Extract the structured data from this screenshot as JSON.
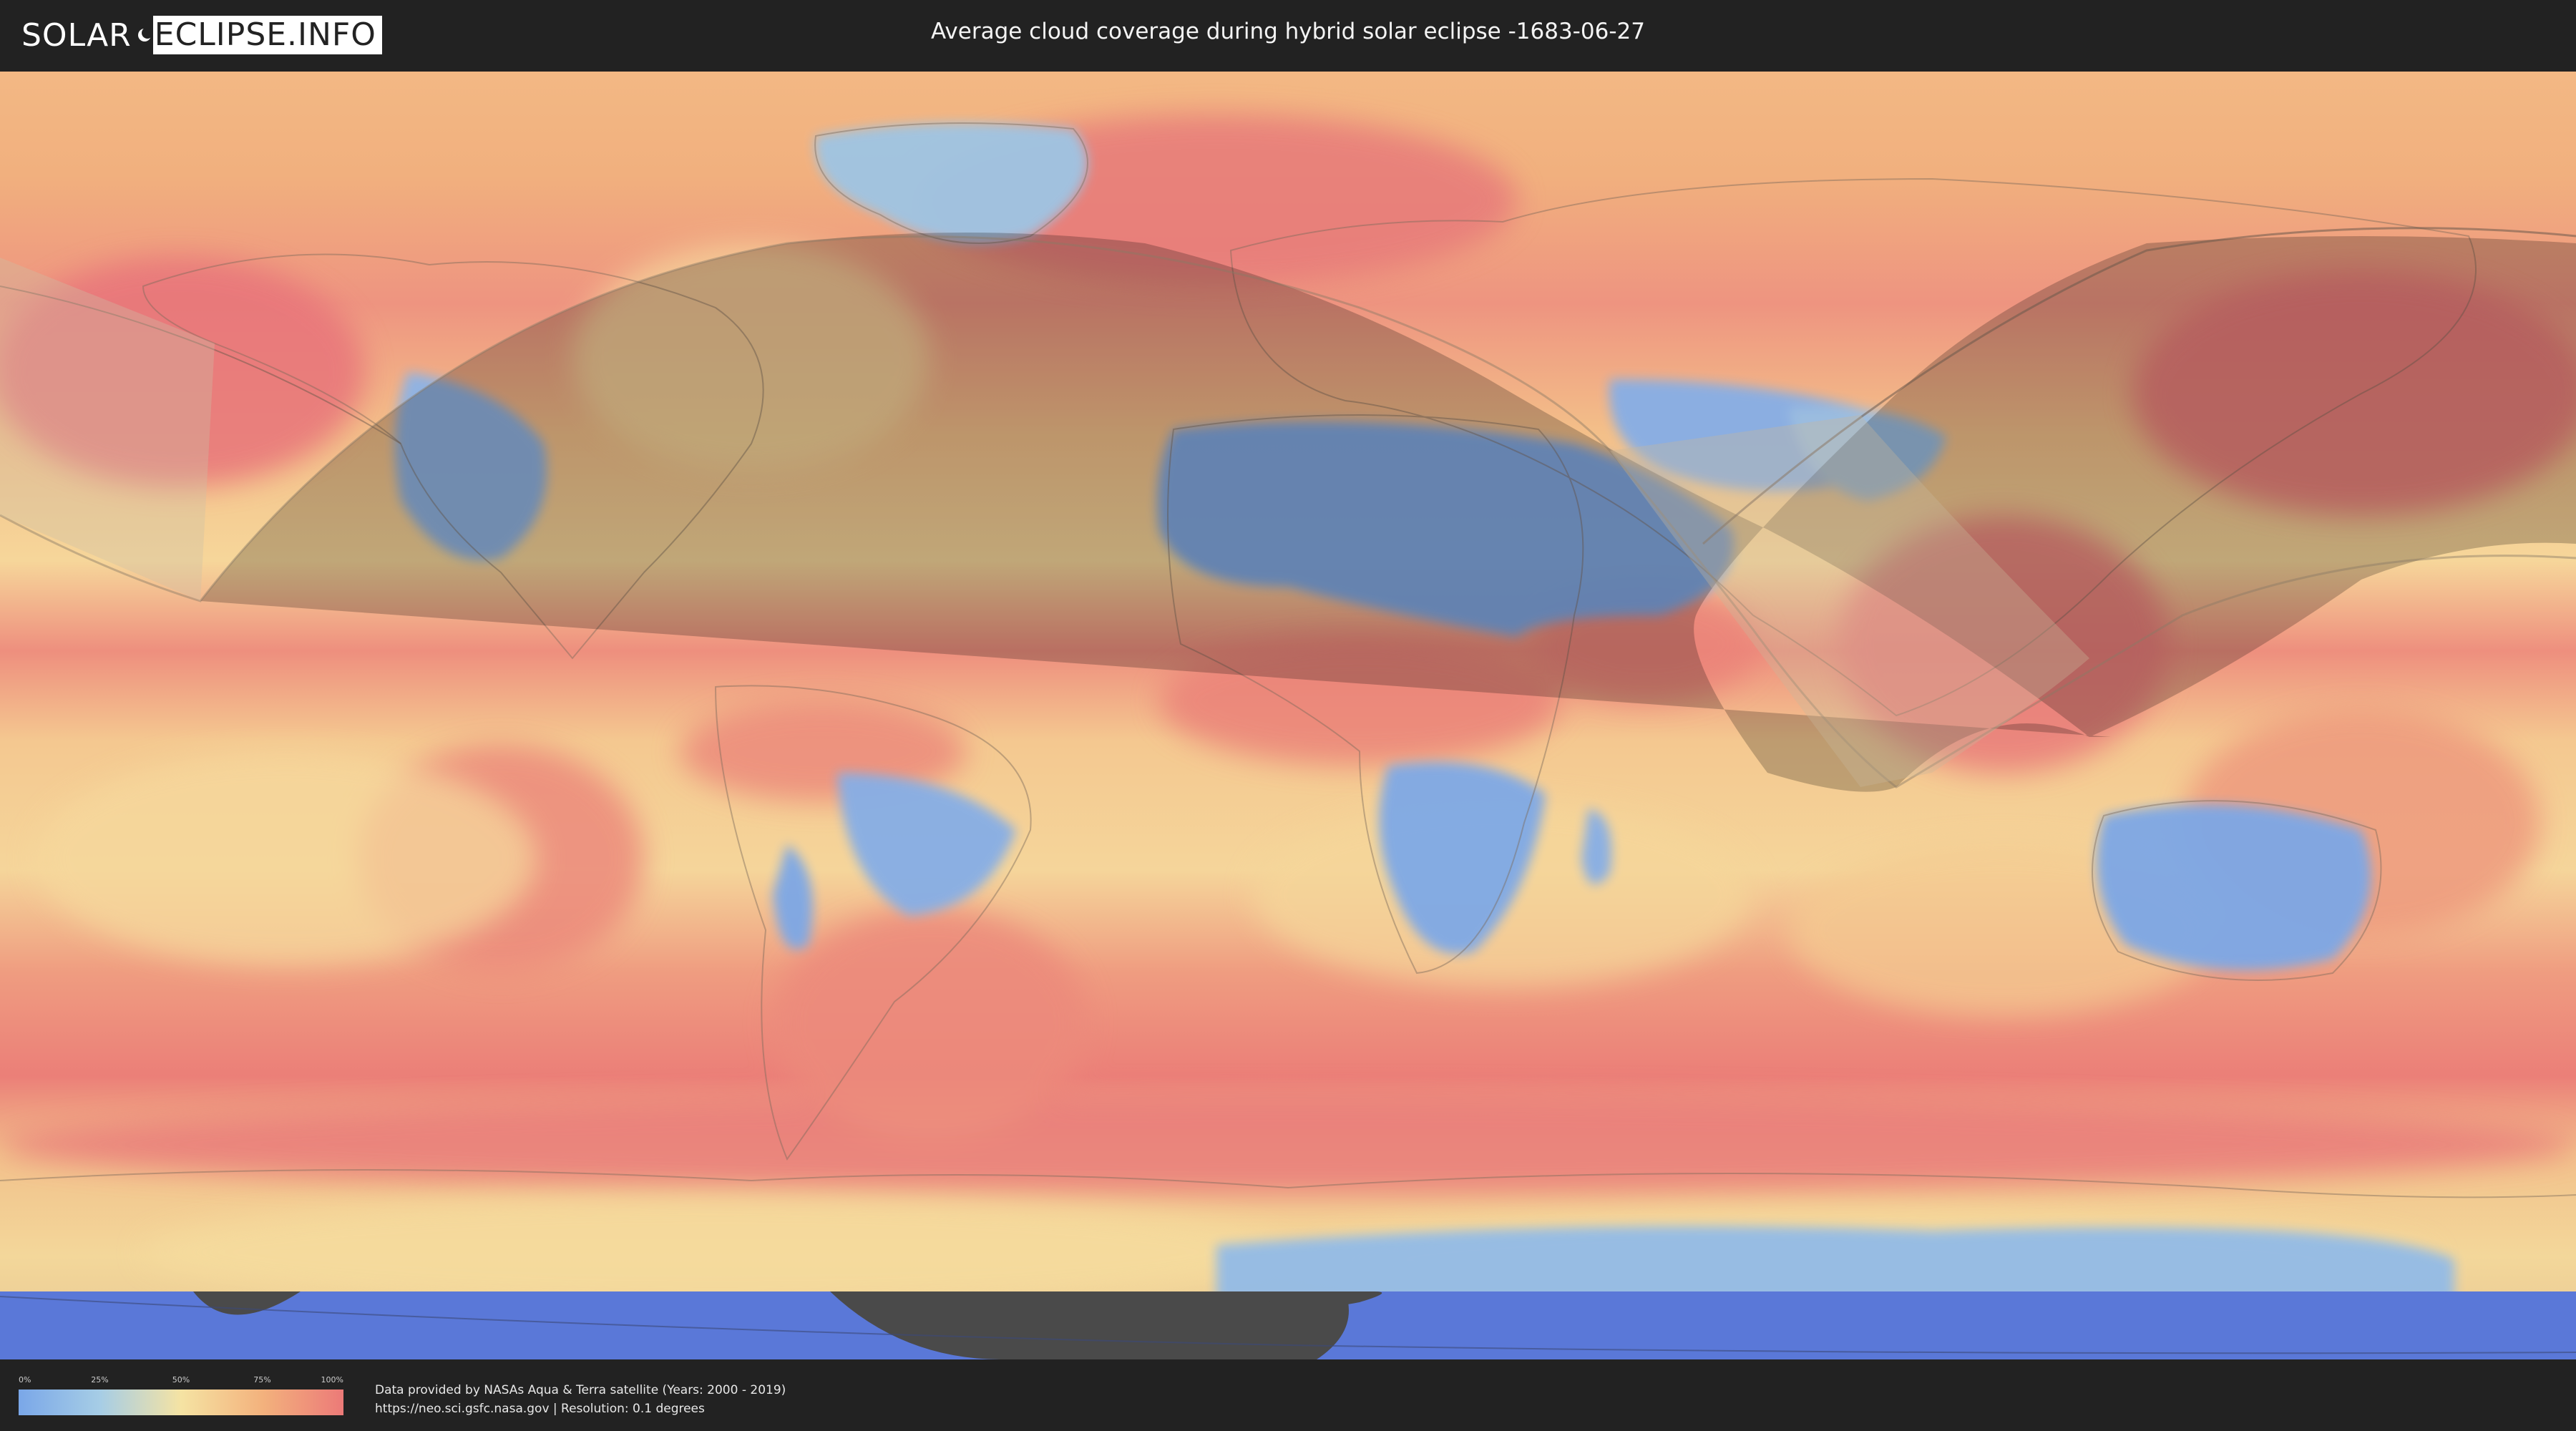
{
  "header": {
    "logo_left": "SOLAR",
    "logo_right": "ECLIPSE.INFO",
    "title": "Average cloud coverage during hybrid solar eclipse -1683-06-27"
  },
  "legend": {
    "ticks": [
      "0%",
      "25%",
      "50%",
      "75%",
      "100%"
    ],
    "colors": [
      "#7aa7e8",
      "#a6cde6",
      "#f5e3a3",
      "#f3b27d",
      "#ec7a78"
    ]
  },
  "footer": {
    "source_line1": "Data provided by NASAs Aqua & Terra satellite (Years: 2000 - 2019)",
    "source_line2": "https://neo.sci.gsfc.nasa.gov | Resolution: 0.1 degrees"
  },
  "map": {
    "description_colors": {
      "clear": "#7aa7e8",
      "low": "#a6cde6",
      "mid": "#f5e3a3",
      "high": "#f3b27d",
      "full": "#ec7a78",
      "polar": "#5577dd",
      "shadow": "#555555"
    }
  }
}
